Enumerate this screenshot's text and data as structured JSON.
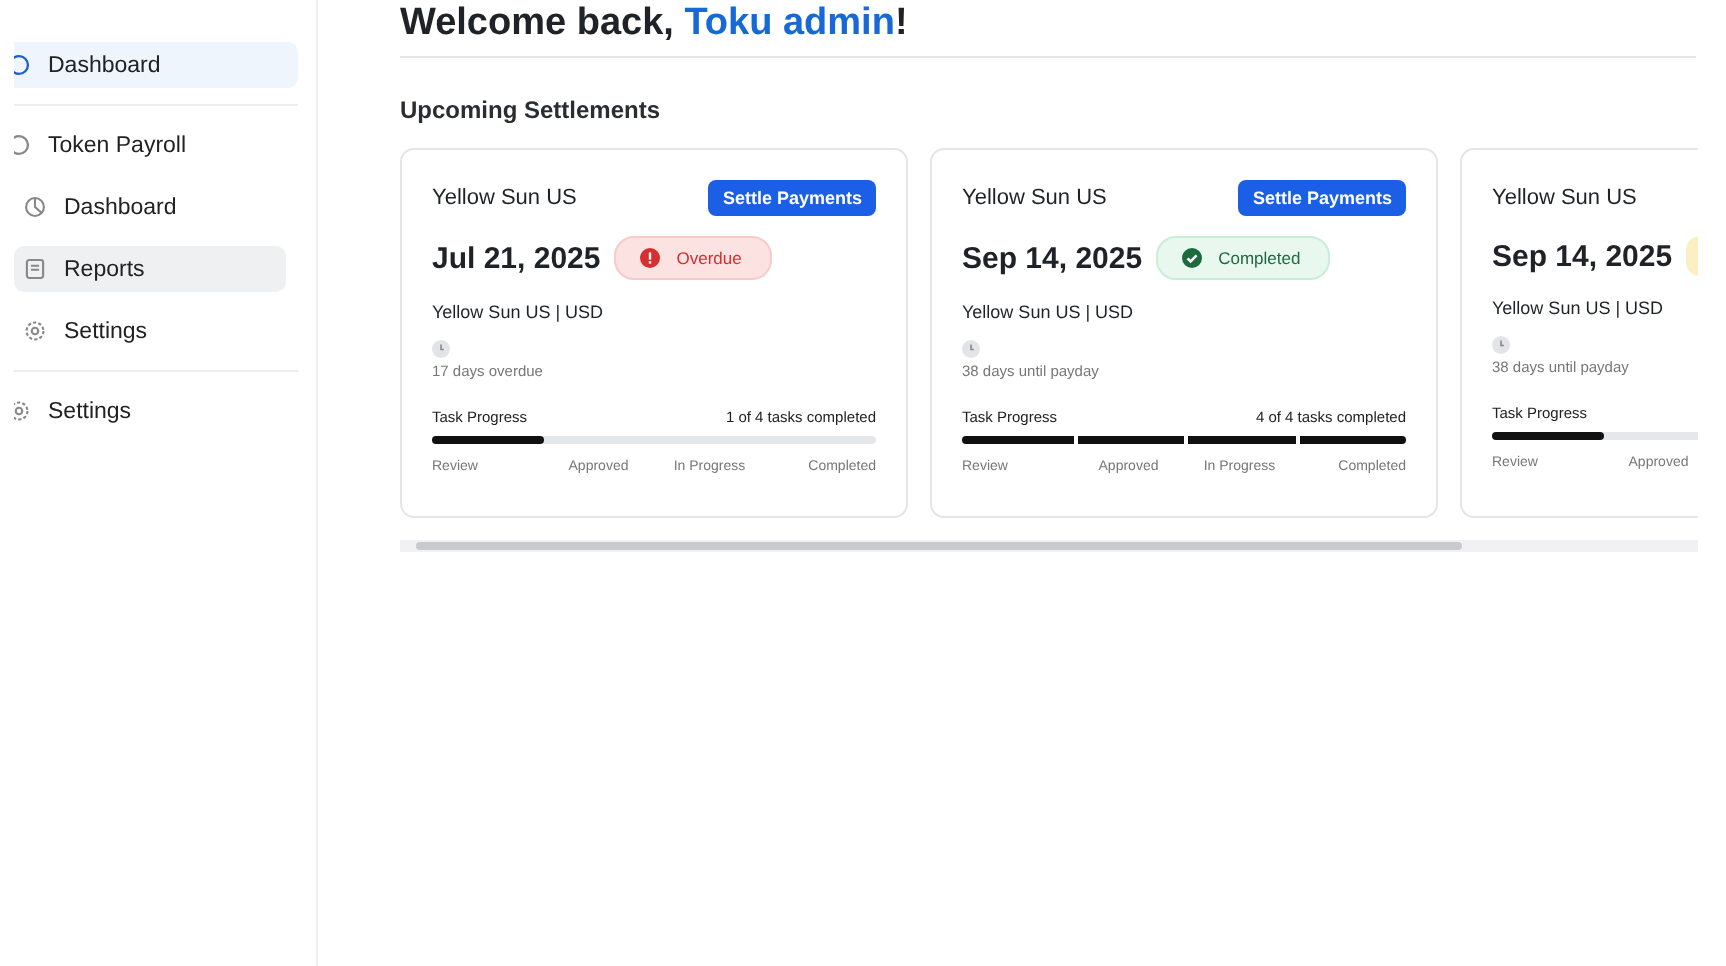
{
  "sidebar": {
    "items": [
      {
        "label": "Dashboard",
        "selected": true
      },
      {
        "label": "Token Payroll",
        "selected": false,
        "children": [
          {
            "label": "Dashboard",
            "selected": false
          },
          {
            "label": "Reports",
            "selected": true
          },
          {
            "label": "Settings",
            "selected": false
          }
        ]
      },
      {
        "label": "Settings",
        "selected": false
      }
    ]
  },
  "header": {
    "greeting": "Welcome back, ",
    "user": "Toku admin",
    "suffix": "!"
  },
  "section_title": "Upcoming Settlements",
  "settlements": [
    {
      "company": "Yellow Sun US",
      "button": "Settle Payments",
      "date": "Jul 21, 2025",
      "status": {
        "kind": "overdue",
        "label": "Overdue"
      },
      "account": "Yellow Sun US | USD",
      "note": "17 days overdue",
      "progress_label": "Task Progress",
      "progress_text": "1 of 4 tasks completed",
      "level": 0.25,
      "stages": [
        "Review",
        "Approved",
        "In Progress",
        "Completed"
      ]
    },
    {
      "company": "Yellow Sun US",
      "button": "Settle Payments",
      "date": "Sep 14, 2025",
      "status": {
        "kind": "completed",
        "label": "Completed"
      },
      "account": "Yellow Sun US | USD",
      "note": "38 days until payday",
      "progress_label": "Task Progress",
      "progress_text": "4 of 4 tasks completed",
      "level": 1,
      "stages": [
        "Review",
        "Approved",
        "In Progress",
        "Completed"
      ]
    },
    {
      "company": "Yellow Sun US",
      "date": "Sep 14, 2025",
      "status": {
        "kind": "pending"
      },
      "account": "Yellow Sun US | USD",
      "note": "38 days until payday",
      "progress_label": "Task Progress",
      "level": 0.25,
      "stages": [
        "Review",
        "Approved"
      ]
    }
  ]
}
